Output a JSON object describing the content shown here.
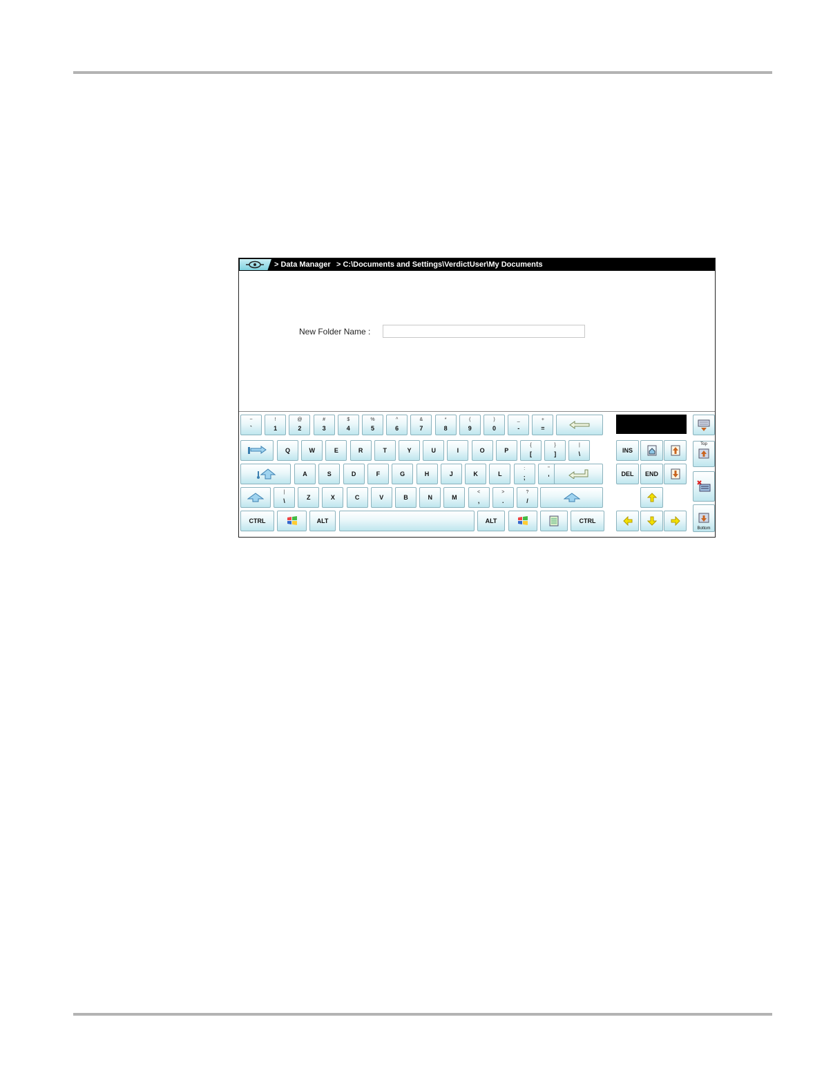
{
  "window": {
    "breadcrumb_1": "> Data Manager",
    "breadcrumb_2": "> C:\\Documents and Settings\\VerdictUser\\My Documents"
  },
  "form": {
    "label": "New Folder Name :",
    "value": ""
  },
  "keyboard": {
    "row1": [
      {
        "top": "~",
        "bot": "`"
      },
      {
        "top": "!",
        "bot": "1"
      },
      {
        "top": "@",
        "bot": "2"
      },
      {
        "top": "#",
        "bot": "3"
      },
      {
        "top": "$",
        "bot": "4"
      },
      {
        "top": "%",
        "bot": "5"
      },
      {
        "top": "^",
        "bot": "6"
      },
      {
        "top": "&",
        "bot": "7"
      },
      {
        "top": "*",
        "bot": "8"
      },
      {
        "top": "(",
        "bot": "9"
      },
      {
        "top": ")",
        "bot": "0"
      },
      {
        "top": "_",
        "bot": "-"
      },
      {
        "top": "+",
        "bot": "="
      }
    ],
    "row2": [
      {
        "label": "Q"
      },
      {
        "label": "W"
      },
      {
        "label": "E"
      },
      {
        "label": "R"
      },
      {
        "label": "T"
      },
      {
        "label": "Y"
      },
      {
        "label": "U"
      },
      {
        "label": "I"
      },
      {
        "label": "O"
      },
      {
        "label": "P"
      },
      {
        "top": "{",
        "bot": "["
      },
      {
        "top": "}",
        "bot": "]"
      },
      {
        "top": "|",
        "bot": "\\"
      }
    ],
    "row3": [
      {
        "label": "A"
      },
      {
        "label": "S"
      },
      {
        "label": "D"
      },
      {
        "label": "F"
      },
      {
        "label": "G"
      },
      {
        "label": "H"
      },
      {
        "label": "J"
      },
      {
        "label": "K"
      },
      {
        "label": "L"
      },
      {
        "top": ":",
        "bot": ";"
      },
      {
        "top": "\"",
        "bot": "'"
      }
    ],
    "row4": [
      {
        "top": "|",
        "bot": "\\"
      },
      {
        "label": "Z"
      },
      {
        "label": "X"
      },
      {
        "label": "C"
      },
      {
        "label": "V"
      },
      {
        "label": "B"
      },
      {
        "label": "N"
      },
      {
        "label": "M"
      },
      {
        "top": "<",
        "bot": ","
      },
      {
        "top": ">",
        "bot": "."
      },
      {
        "top": "?",
        "bot": "/"
      }
    ],
    "ctrl_left": "CTRL",
    "alt_left": "ALT",
    "alt_right": "ALT",
    "ctrl_right": "CTRL",
    "ins": "INS",
    "del": "DEL",
    "end": "END",
    "top_label": "Top",
    "bottom_label": "Bottom",
    "icons": {
      "backspace": "left-arrow-icon",
      "tab": "tab-icon",
      "caps": "caps-lock-icon",
      "enter": "enter-icon",
      "shift": "shift-up-icon",
      "windows": "windows-logo-icon",
      "menu": "context-menu-icon",
      "home": "home-icon",
      "page_up": "page-up-icon",
      "page_down": "page-down-icon",
      "arrow_up": "arrow-up-icon",
      "arrow_down": "arrow-down-icon",
      "arrow_left": "arrow-left-icon",
      "arrow_right": "arrow-right-icon",
      "move_up": "keyboard-move-up-icon",
      "move_top": "keyboard-move-top-icon",
      "close": "close-keyboard-icon",
      "move_bottom": "keyboard-move-bottom-icon"
    },
    "colors": {
      "key_top": "#ffffff",
      "key_bottom": "#bfe6ee",
      "key_border": "#8ab2bd",
      "arrow_yellow": "#f3e200"
    }
  }
}
